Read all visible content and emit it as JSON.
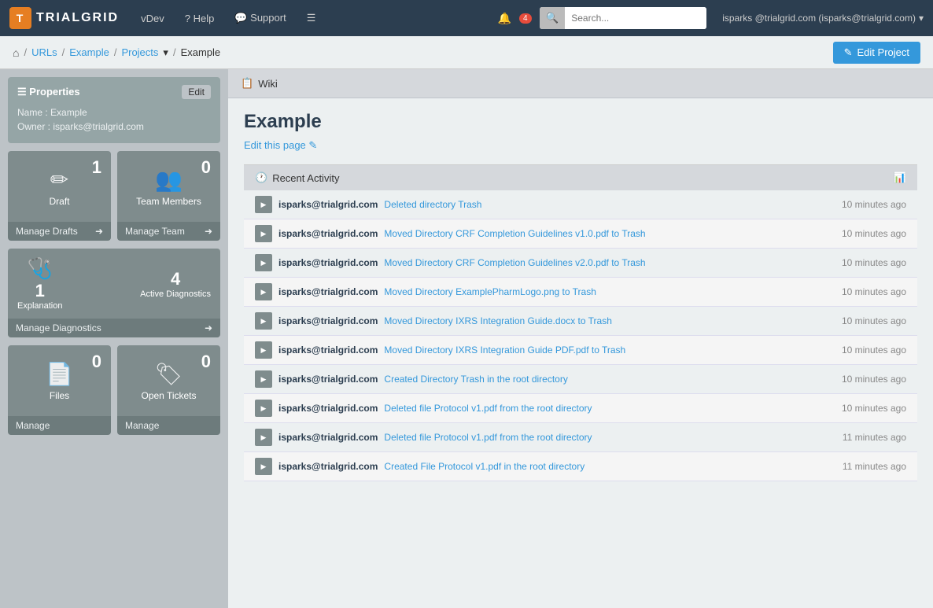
{
  "navbar": {
    "brand": "TRIALGRID",
    "logo_letter": "T",
    "links": [
      {
        "label": "vDev",
        "id": "vdev"
      },
      {
        "label": "Help",
        "id": "help"
      },
      {
        "label": "Support",
        "id": "support"
      },
      {
        "label": "≡",
        "id": "menu"
      }
    ],
    "search_placeholder": "Search...",
    "user": "isparks @trialgrid.com (isparks@trialgrid.com)"
  },
  "breadcrumb": {
    "home_icon": "⌂",
    "items": [
      "URLs",
      "Example",
      "Projects",
      "Example"
    ],
    "edit_button": "Edit Project"
  },
  "sidebar": {
    "properties": {
      "title": "Properties",
      "edit_label": "Edit",
      "name_label": "Name : Example",
      "owner_label": "Owner : isparks@trialgrid.com"
    },
    "widgets": [
      {
        "id": "drafts",
        "icon": "✏",
        "count": "1",
        "label": "Draft",
        "action": "Manage Drafts"
      },
      {
        "id": "team",
        "icon": "👥",
        "count": "0",
        "label": "Team Members",
        "action": "Manage Team"
      }
    ],
    "diagnostics": {
      "icon": "🩺",
      "explanation_label": "Explanation",
      "explanation_count": "1",
      "active_label": "Active Diagnostics",
      "active_count": "4",
      "action": "Manage Diagnostics"
    },
    "bottom_widgets": [
      {
        "id": "files",
        "icon": "📄",
        "count": "0",
        "label": "Files",
        "action": "Manage"
      },
      {
        "id": "tickets",
        "icon": "🏷",
        "count": "0",
        "label": "Open Tickets",
        "action": "Manage"
      }
    ]
  },
  "wiki": {
    "section_label": "Wiki",
    "title": "Example",
    "edit_link": "Edit this page"
  },
  "activity": {
    "title": "Recent Activity",
    "items": [
      {
        "user": "isparks@trialgrid.com",
        "action": "Deleted directory Trash",
        "time": "10 minutes ago"
      },
      {
        "user": "isparks@trialgrid.com",
        "action": "Moved Directory CRF Completion Guidelines v1.0.pdf to Trash",
        "time": "10 minutes ago"
      },
      {
        "user": "isparks@trialgrid.com",
        "action": "Moved Directory CRF Completion Guidelines v2.0.pdf to Trash",
        "time": "10 minutes ago"
      },
      {
        "user": "isparks@trialgrid.com",
        "action": "Moved Directory ExamplePharmLogo.png to Trash",
        "time": "10 minutes ago"
      },
      {
        "user": "isparks@trialgrid.com",
        "action": "Moved Directory IXRS Integration Guide.docx to Trash",
        "time": "10 minutes ago"
      },
      {
        "user": "isparks@trialgrid.com",
        "action": "Moved Directory IXRS Integration Guide PDF.pdf to Trash",
        "time": "10 minutes ago"
      },
      {
        "user": "isparks@trialgrid.com",
        "action": "Created Directory Trash in the root directory",
        "time": "10 minutes ago"
      },
      {
        "user": "isparks@trialgrid.com",
        "action": "Deleted file Protocol v1.pdf from the root directory",
        "time": "10 minutes ago"
      },
      {
        "user": "isparks@trialgrid.com",
        "action": "Deleted file Protocol v1.pdf from the root directory",
        "time": "11 minutes ago"
      },
      {
        "user": "isparks@trialgrid.com",
        "action": "Created File Protocol v1.pdf in the root directory",
        "time": "11 minutes ago"
      }
    ]
  }
}
